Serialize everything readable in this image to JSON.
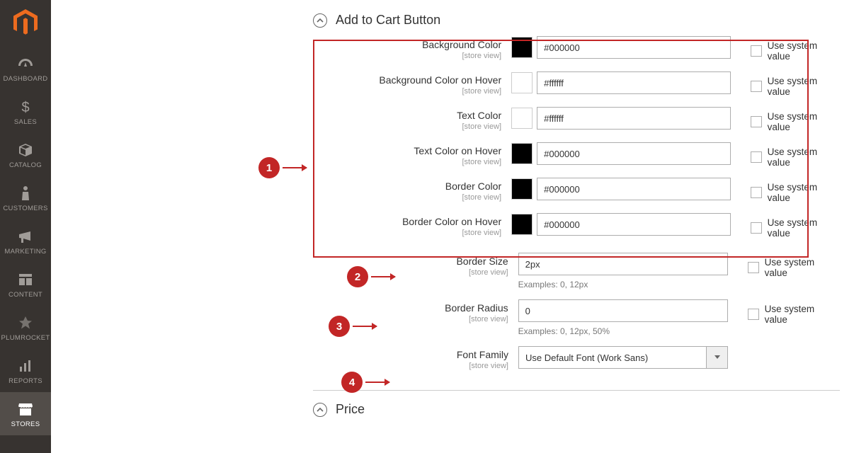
{
  "sidebar": {
    "items": [
      {
        "label": "DASHBOARD",
        "icon": "dashboard-icon"
      },
      {
        "label": "SALES",
        "icon": "dollar-icon"
      },
      {
        "label": "CATALOG",
        "icon": "box-icon"
      },
      {
        "label": "CUSTOMERS",
        "icon": "person-icon"
      },
      {
        "label": "MARKETING",
        "icon": "megaphone-icon"
      },
      {
        "label": "CONTENT",
        "icon": "layout-icon"
      },
      {
        "label": "PLUMROCKET",
        "icon": "plumrocket-icon"
      },
      {
        "label": "REPORTS",
        "icon": "barchart-icon"
      },
      {
        "label": "STORES",
        "icon": "stores-icon"
      }
    ]
  },
  "sections": {
    "add_to_cart": {
      "title": "Add to Cart Button"
    },
    "price": {
      "title": "Price"
    }
  },
  "scope_label": "[store view]",
  "use_system_value_label": "Use system value",
  "fields": {
    "bg_color": {
      "label": "Background Color",
      "value": "#000000",
      "swatch": "#000000"
    },
    "bg_color_hover": {
      "label": "Background Color on Hover",
      "value": "#ffffff",
      "swatch": "#ffffff"
    },
    "text_color": {
      "label": "Text Color",
      "value": "#ffffff",
      "swatch": "#ffffff"
    },
    "text_color_hover": {
      "label": "Text Color on Hover",
      "value": "#000000",
      "swatch": "#000000"
    },
    "border_color": {
      "label": "Border Color",
      "value": "#000000",
      "swatch": "#000000"
    },
    "border_color_hover": {
      "label": "Border Color on Hover",
      "value": "#000000",
      "swatch": "#000000"
    },
    "border_size": {
      "label": "Border Size",
      "value": "2px",
      "hint": "Examples: 0, 12px"
    },
    "border_radius": {
      "label": "Border Radius",
      "value": "0",
      "hint": "Examples: 0, 12px, 50%"
    },
    "font_family": {
      "label": "Font Family",
      "value": "Use Default Font (Work Sans)"
    }
  },
  "annotations": {
    "n1": "1",
    "n2": "2",
    "n3": "3",
    "n4": "4"
  }
}
